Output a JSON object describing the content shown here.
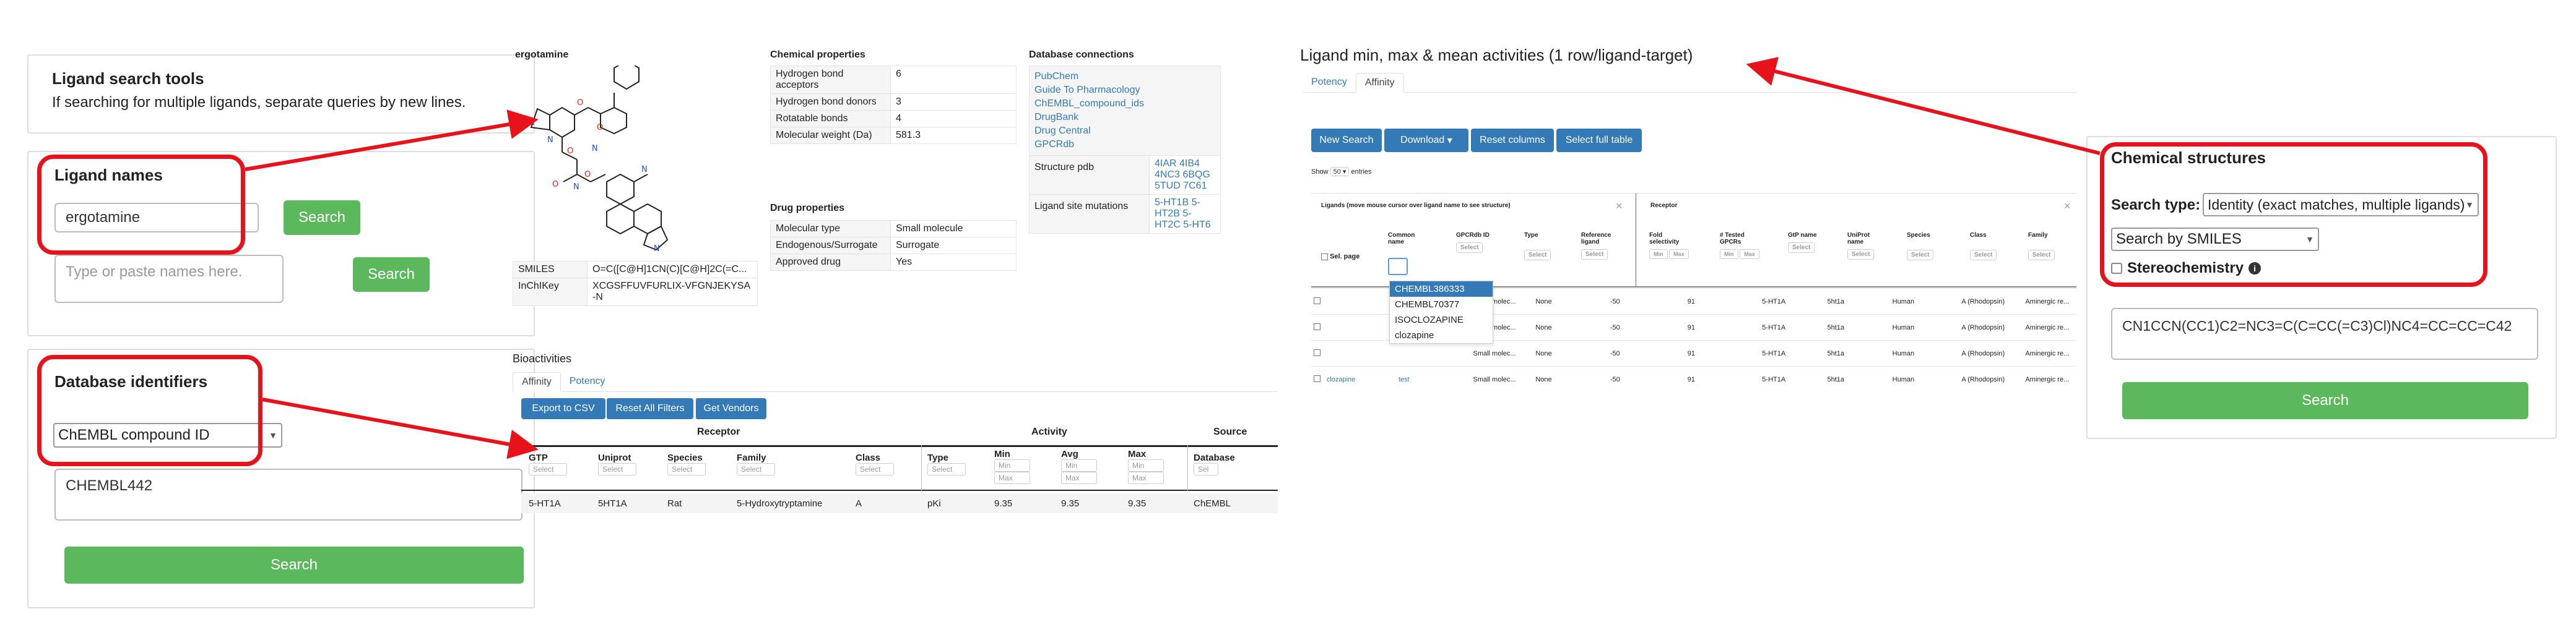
{
  "left": {
    "tools": {
      "title": "Ligand search tools",
      "hint": "If searching for multiple ligands, separate queries by new lines."
    },
    "names": {
      "title": "Ligand names",
      "input_value": "ergotamine",
      "search_label": "Search",
      "textarea_placeholder": "Type or paste names here.",
      "search2_label": "Search"
    },
    "db": {
      "title": "Database identifiers",
      "select_value": "ChEMBL compound ID",
      "textarea_value": "CHEMBL442",
      "search_label": "Search"
    }
  },
  "ligand": {
    "name": "ergotamine",
    "smiles_label": "SMILES",
    "smiles_value": "O=C([C@H]1CN(C)[C@H]2C(=C...",
    "inchikey_label": "InChIKey",
    "inchikey_value": "XCGSFFUVFURLIX-VFGNJEKYSA-N",
    "chem_props_title": "Chemical properties",
    "chem_props": [
      {
        "k": "Hydrogen bond acceptors",
        "v": "6"
      },
      {
        "k": "Hydrogen bond donors",
        "v": "3"
      },
      {
        "k": "Rotatable bonds",
        "v": "4"
      },
      {
        "k": "Molecular weight (Da)",
        "v": "581.3"
      }
    ],
    "drug_props_title": "Drug properties",
    "drug_props": [
      {
        "k": "Molecular type",
        "v": "Small molecule"
      },
      {
        "k": "Endogenous/Surrogate",
        "v": "Surrogate"
      },
      {
        "k": "Approved drug",
        "v": "Yes"
      }
    ],
    "db_conn_title": "Database connections",
    "db_links": [
      "PubChem",
      "Guide To Pharmacology",
      "ChEMBL_compound_ids",
      "DrugBank",
      "Drug Central",
      "GPCRdb"
    ],
    "structure_pdb_label": "Structure pdb",
    "structure_pdb_value": "4IAR 4IB4 4NC3 6BQG 5TUD 7C61",
    "site_mut_label": "Ligand site mutations",
    "site_mut_value": "5-HT1B 5-HT2B 5-HT2C 5-HT6"
  },
  "bio": {
    "title": "Bioactivities",
    "tabs": [
      "Affinity",
      "Potency"
    ],
    "buttons": [
      "Export to CSV",
      "Reset All Filters",
      "Get Vendors"
    ],
    "groups": [
      "Receptor",
      "Activity",
      "Source"
    ],
    "columns": [
      "GTP",
      "Uniprot",
      "Species",
      "Family",
      "Class",
      "Type",
      "Min",
      "Avg",
      "Max",
      "Database"
    ],
    "filter_select": "Select",
    "filter_min": "Min",
    "filter_max": "Max",
    "filter_sel": "Sel",
    "row": [
      "5-HT1A",
      "5HT1A",
      "Rat",
      "5-Hydroxytryptamine",
      "A",
      "pKi",
      "9.35",
      "9.35",
      "9.35",
      "ChEMBL"
    ]
  },
  "ranges": {
    "title": "Ligand min, max & mean activities (1 row/ligand-target)",
    "tabs": [
      "Potency",
      "Affinity"
    ],
    "buttons": [
      "New Search",
      "Download",
      "Reset columns",
      "Select full table"
    ],
    "show_prefix": "Show",
    "show_value": "50",
    "show_suffix": "entries",
    "group_ligands": "Ligands (move mouse cursor over ligand name to see structure)",
    "group_receptor": "Receptor",
    "sel_page": "Sel. page",
    "columns": [
      "Common name",
      "GPCRdb ID",
      "Type",
      "Reference ligand",
      "Fold selectivity",
      "# Tested GPCRs",
      "GtP name",
      "UniProt name",
      "Species",
      "Class",
      "Family"
    ],
    "filter_select": "Select",
    "filter_min": "Min",
    "filter_max": "Max",
    "dropdown": [
      "CHEMBL386333",
      "CHEMBL70377",
      "ISOCLOZAPINE",
      "clozapine"
    ],
    "rows": [
      [
        "",
        "",
        "Small molec...",
        "None",
        "-50",
        "91",
        "5-HT1A",
        "5ht1a",
        "Human",
        "A (Rhodopsin)",
        "Aminergic re..."
      ],
      [
        "",
        "",
        "Small molec...",
        "None",
        "-50",
        "91",
        "5-HT1A",
        "5ht1a",
        "Human",
        "A (Rhodopsin)",
        "Aminergic re..."
      ],
      [
        "",
        "",
        "Small molec...",
        "None",
        "-50",
        "91",
        "5-HT1A",
        "5ht1a",
        "Human",
        "A (Rhodopsin)",
        "Aminergic re..."
      ],
      [
        "clozapine",
        "test",
        "Small molec...",
        "None",
        "-50",
        "91",
        "5-HT1A",
        "5ht1a",
        "Human",
        "A (Rhodopsin)",
        "Aminergic re..."
      ]
    ]
  },
  "chem": {
    "title": "Chemical structures",
    "search_type_label": "Search type:",
    "search_type_value": "Identity (exact matches, multiple ligands)",
    "search_by_value": "Search by SMILES",
    "stereo_label": "Stereochemistry",
    "smiles_input": "CN1CCN(CC1)C2=NC3=C(C=CC(=C3)Cl)NC4=CC=CC=C42",
    "search_label": "Search"
  },
  "colors": {
    "highlight": "#e8131a",
    "success": "#5cb85c",
    "primary": "#337ab7"
  }
}
